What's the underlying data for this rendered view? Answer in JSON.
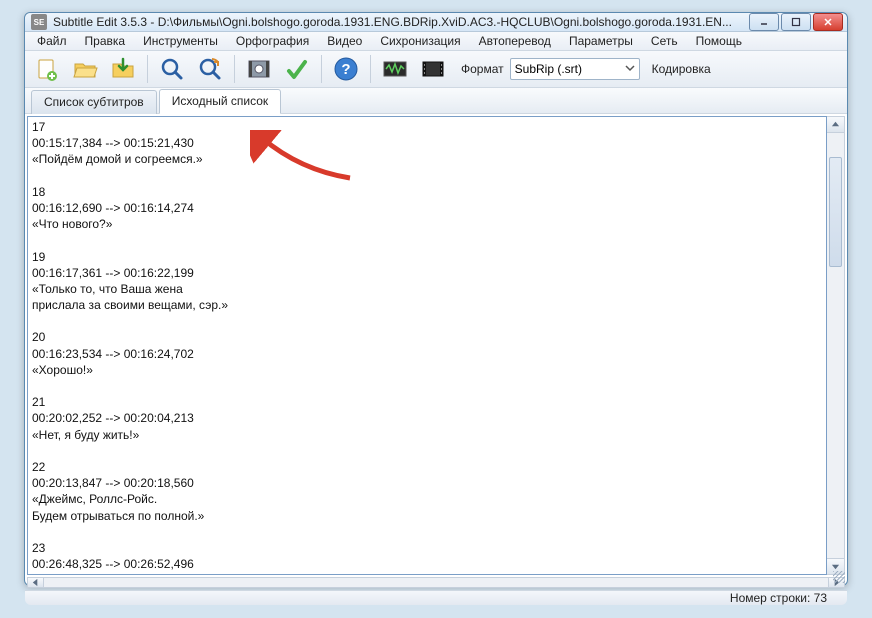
{
  "window": {
    "appicon_text": "SE",
    "title": "Subtitle Edit 3.5.3 - D:\\Фильмы\\Ogni.bolshogo.goroda.1931.ENG.BDRip.XviD.AC3.-HQCLUB\\Ogni.bolshogo.goroda.1931.EN..."
  },
  "menu": {
    "items": [
      "Файл",
      "Правка",
      "Инструменты",
      "Орфография",
      "Видео",
      "Сихронизация",
      "Автоперевод",
      "Параметры",
      "Сеть",
      "Помощь"
    ]
  },
  "toolbar": {
    "format_label": "Формат",
    "format_value": "SubRip (.srt)",
    "encoding_label": "Кодировка"
  },
  "tabs": {
    "list": "Список субтитров",
    "source": "Исходный список"
  },
  "subtitles": [
    {
      "idx": "17",
      "time": "00:15:17,384 --> 00:15:21,430",
      "lines": [
        "«Пойдём домой и согреемся.»"
      ]
    },
    {
      "idx": "18",
      "time": "00:16:12,690 --> 00:16:14,274",
      "lines": [
        "«Что нового?»"
      ]
    },
    {
      "idx": "19",
      "time": "00:16:17,361 --> 00:16:22,199",
      "lines": [
        "«Только то, что Ваша жена",
        "прислала за своими вещами, сэр.»"
      ]
    },
    {
      "idx": "20",
      "time": "00:16:23,534 --> 00:16:24,702",
      "lines": [
        "«Хорошо!»"
      ]
    },
    {
      "idx": "21",
      "time": "00:20:02,252 --> 00:20:04,213",
      "lines": [
        "«Нет, я буду жить!»"
      ]
    },
    {
      "idx": "22",
      "time": "00:20:13,847 --> 00:20:18,560",
      "lines": [
        "«Джеймс, Роллс-Ройс.",
        "Будем отрываться по полной.»"
      ]
    },
    {
      "idx": "23",
      "time": "00:26:48,325 --> 00:26:52,496",
      "lines": []
    }
  ],
  "status": {
    "line_label": "Номер строки: 73"
  }
}
